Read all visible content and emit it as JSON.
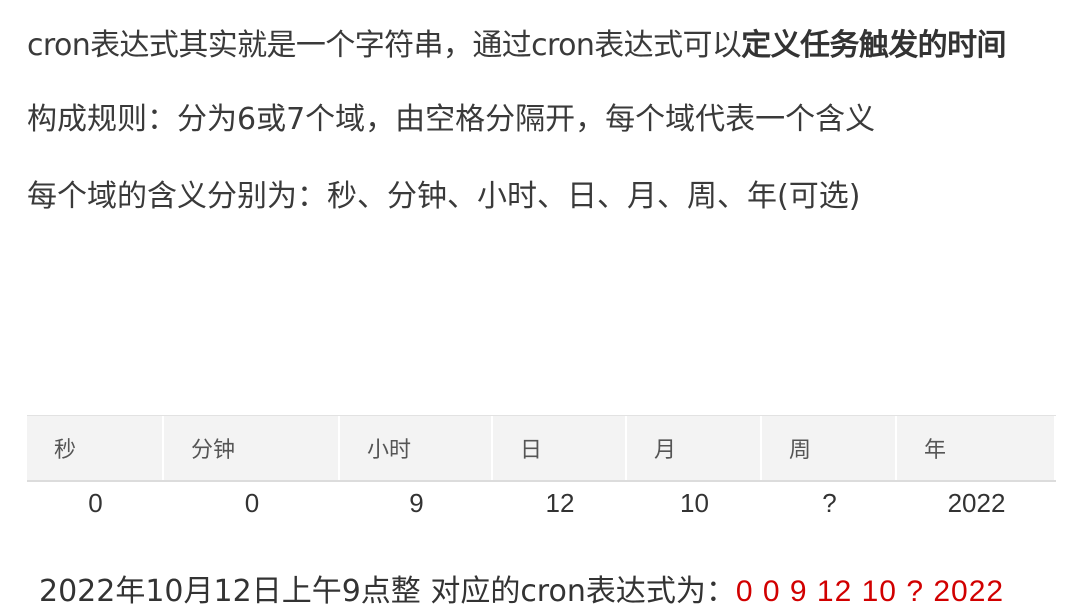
{
  "intro": {
    "line1_prefix": "cron表达式其实就是一个字符串，通过cron表达式可以",
    "line1_bold": "定义任务触发的时间",
    "line2": "构成规则：分为6或7个域，由空格分隔开，每个域代表一个含义",
    "line3": "每个域的含义分别为：秒、分钟、小时、日、月、周、年(可选)"
  },
  "table": {
    "headers": [
      "秒",
      "分钟",
      "小时",
      "日",
      "月",
      "周",
      "年"
    ],
    "values": [
      "0",
      "0",
      "9",
      "12",
      "10",
      "?",
      "2022"
    ]
  },
  "summary": {
    "text": "2022年10月12日上午9点整 对应的cron表达式为：",
    "expression": "0 0 9 12 10 ? 2022"
  },
  "colors": {
    "expression": "#d10000",
    "header_bg": "#f3f3f3"
  }
}
